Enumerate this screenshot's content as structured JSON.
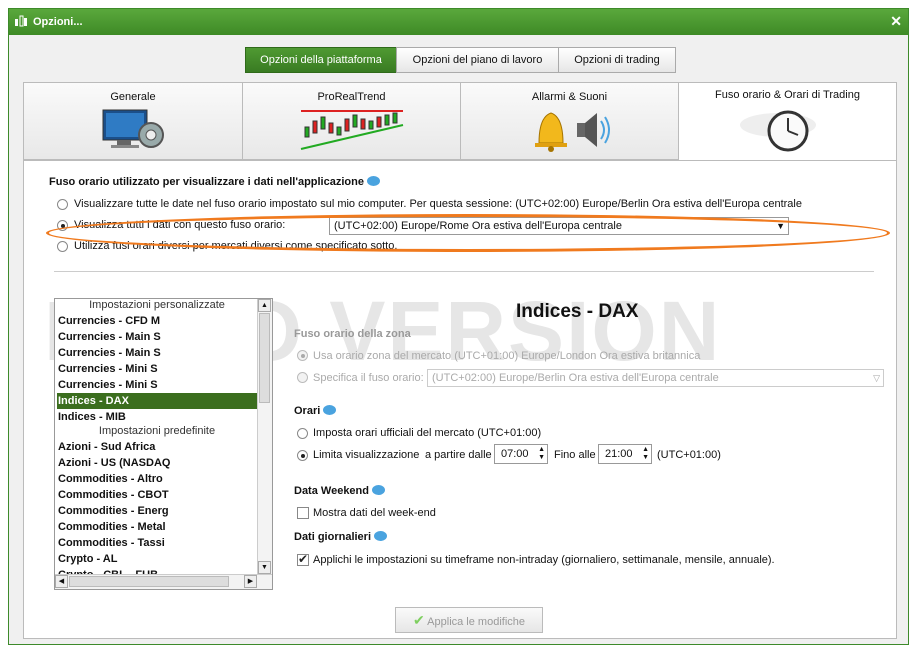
{
  "window": {
    "title": "Opzioni...",
    "close": "✕"
  },
  "top_tabs": [
    "Opzioni della piattaforma",
    "Opzioni del piano di lavoro",
    "Opzioni di trading"
  ],
  "categories": [
    "Generale",
    "ProRealTrend",
    "Allarmi & Suoni",
    "Fuso orario & Orari di Trading"
  ],
  "timezone": {
    "heading": "Fuso orario utilizzato per visualizzare i dati nell'applicazione",
    "option1": "Visualizzare tutte le date nel fuso orario impostato sul mio computer. Per questa sessione: (UTC+02:00) Europe/Berlin Ora estiva dell'Europa centrale",
    "option2": "Visualizza tutti i dati con questo fuso orario:",
    "option2_value": "(UTC+02:00) Europe/Rome Ora estiva dell'Europa centrale",
    "option3": "Utilizza fusi orari diversi per mercati diversi come specificato sotto."
  },
  "watermark": "DEMO VERSION",
  "list": {
    "header_custom": "Impostazioni personalizzate",
    "custom_items": [
      "Currencies - CFD M",
      "Currencies - Main S",
      "Currencies - Main S",
      "Currencies - Mini S",
      "Currencies - Mini S",
      "Indices - DAX",
      "Indices - MIB"
    ],
    "header_predefined": "Impostazioni predefinite",
    "predefined_items": [
      "Azioni - Sud Africa",
      "Azioni - US (NASDAQ",
      "Commodities - Altro",
      "Commodities - CBOT",
      "Commodities - Energ",
      "Commodities - Metal",
      "Commodities - Tassi",
      "Crypto - AL"
    ],
    "partial_item": "Crypto - CBL - FUB"
  },
  "detail": {
    "title": "Indices - DAX",
    "zone_heading": "Fuso orario della zona",
    "zone_opt1": "Usa orario zona del mercato (UTC+01:00) Europe/London Ora estiva britannica",
    "zone_opt2": "Specifica il fuso orario:",
    "zone_opt2_value": "(UTC+02:00) Europe/Berlin Ora estiva dell'Europa centrale",
    "hours_heading": "Orari",
    "hours_opt1": "Imposta orari ufficiali del mercato  (UTC+01:00)",
    "hours_opt2": "Limita visualizzazione",
    "from_label": "a partire dalle",
    "from_value": "07:00",
    "to_label": "Fino alle",
    "to_value": "21:00",
    "utc_label": "(UTC+01:00)",
    "weekend_heading": "Data Weekend",
    "weekend_opt": "Mostra dati del week-end",
    "daily_heading": "Dati giornalieri",
    "daily_opt": "Applichi le impostazioni su timeframe non-intraday (giornaliero, settimanale, mensile, annuale).",
    "apply_button": "Applica le modifiche"
  }
}
